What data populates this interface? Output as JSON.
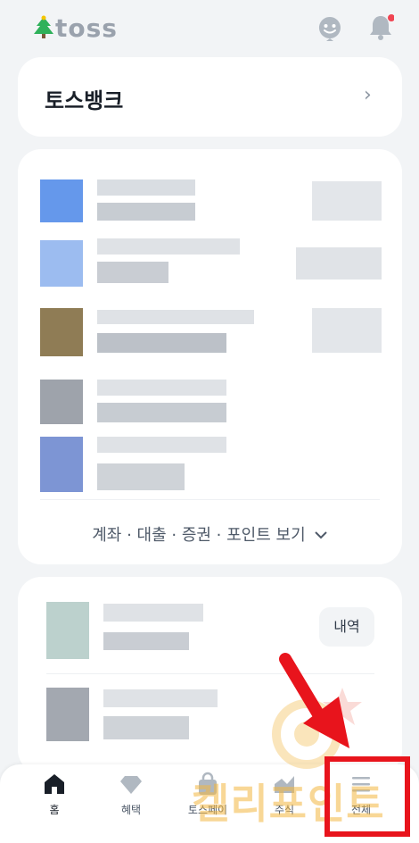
{
  "header": {
    "logo_text": "toss",
    "notification_dot_color": "#f04452"
  },
  "tossbank_card": {
    "title": "토스뱅크"
  },
  "accounts_card": {
    "more_link": "계좌 · 대출 · 증권 · 포인트 보기"
  },
  "history_card": {
    "history_button": "내역"
  },
  "bottom_nav": {
    "items": [
      {
        "label": "홈",
        "icon": "home-icon",
        "active": true
      },
      {
        "label": "혜택",
        "icon": "diamond-icon",
        "active": false
      },
      {
        "label": "토스페이",
        "icon": "bag-icon",
        "active": false
      },
      {
        "label": "주식",
        "icon": "chart-icon",
        "active": false
      },
      {
        "label": "전체",
        "icon": "menu-icon",
        "active": false
      }
    ]
  },
  "annotation": {
    "watermark_text": "켈리포인트",
    "highlight_color": "#e8141c"
  }
}
